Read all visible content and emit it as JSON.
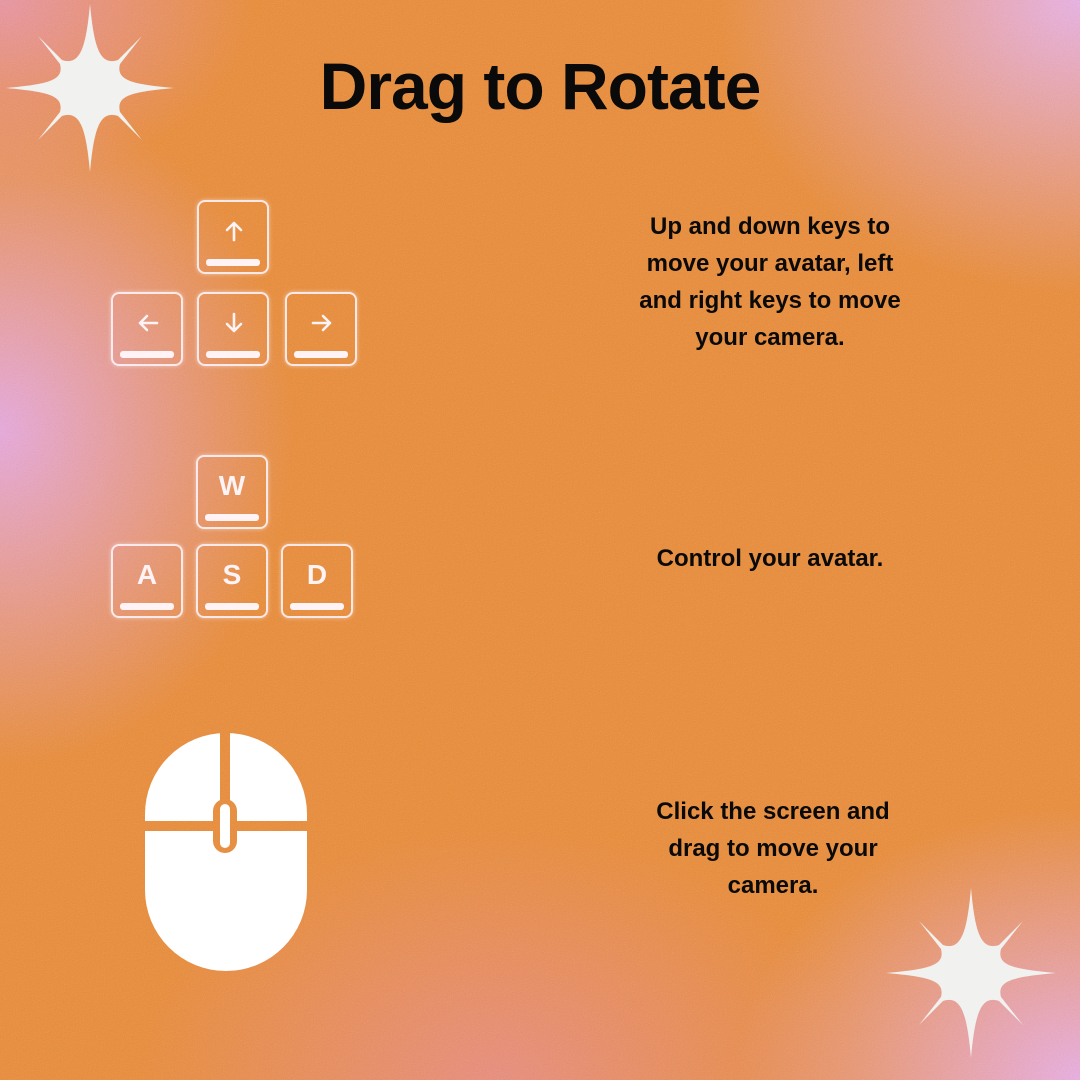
{
  "title": "Drag to Rotate",
  "sections": [
    {
      "id": "arrow-keys",
      "keys": [
        {
          "label": "",
          "icon": "arrow-up-icon"
        },
        {
          "label": "",
          "icon": "arrow-left-icon"
        },
        {
          "label": "",
          "icon": "arrow-down-icon"
        },
        {
          "label": "",
          "icon": "arrow-right-icon"
        }
      ],
      "description_lines": [
        "Up and down keys to",
        "move your avatar, left",
        "and right keys to move",
        "your camera."
      ]
    },
    {
      "id": "wasd-keys",
      "keys": [
        {
          "label": "W"
        },
        {
          "label": "A"
        },
        {
          "label": "S"
        },
        {
          "label": "D"
        }
      ],
      "description_lines": [
        "Control your avatar."
      ]
    },
    {
      "id": "mouse",
      "icon": "mouse-icon",
      "description_lines": [
        "Click the screen and",
        "drag to move your",
        "camera."
      ]
    }
  ],
  "decorations": [
    "sparkle-icon",
    "sparkle-icon"
  ],
  "colors": {
    "orange": "#ed8a32",
    "pink": "#ecb4f0",
    "text": "#0a0a0a",
    "icon_white": "#fff3f6",
    "sparkle": "#f1f1ef"
  }
}
